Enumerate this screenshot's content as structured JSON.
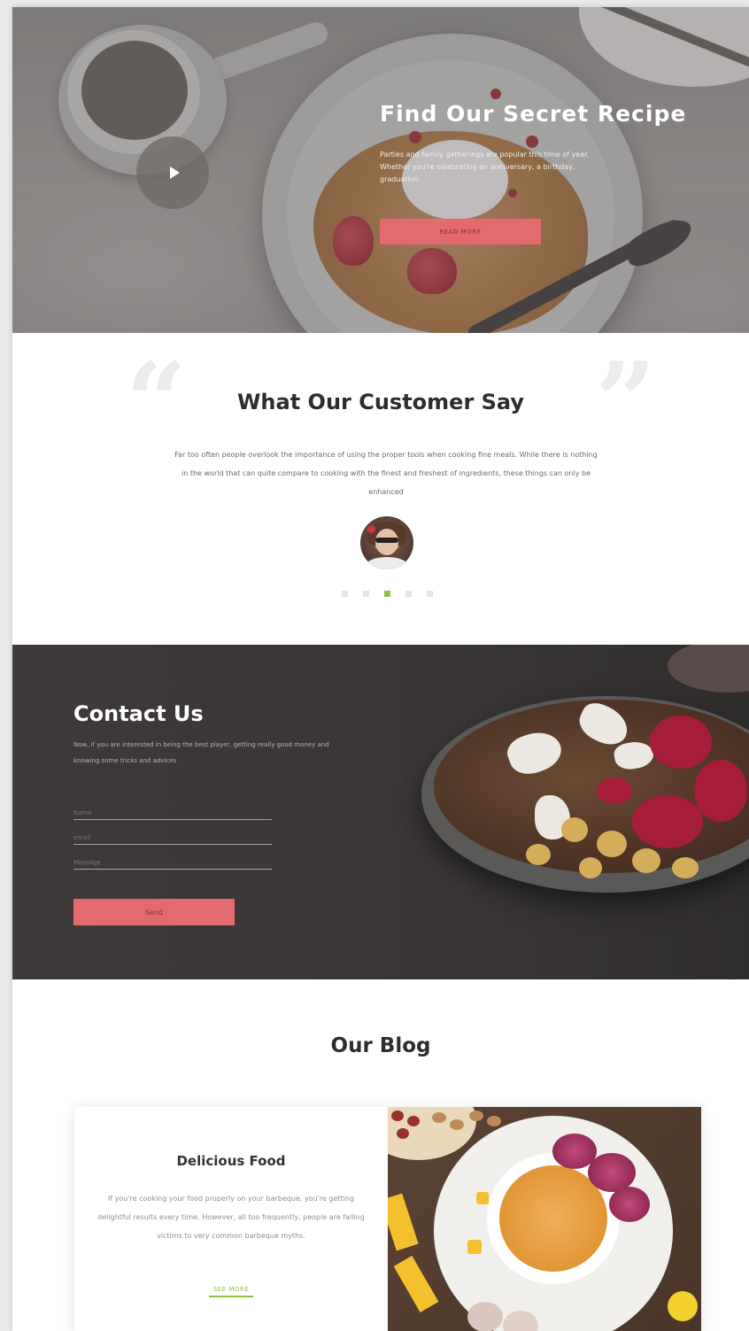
{
  "hero": {
    "title": "Find Our Secret Recipe",
    "text": "Parties and family gatherings are popular this time of year. Whether you're celebrating an anniversary, a birthday, graduation",
    "button_label": "READ MORE"
  },
  "testimonial": {
    "title": "What Our Customer Say",
    "text": "Far too often people overlook the importance of using the proper tools when cooking fine meals. While there is nothing in the world that can quite compare to cooking with the finest and freshest of ingredients, these things can only be enhanced",
    "active_dot": 3,
    "dot_count": 5
  },
  "contact": {
    "title": "Contact Us",
    "text": "Now, if you are interested in being the best player, getting really good money and knowing some tricks and advices",
    "name_placeholder": "Name",
    "email_placeholder": "email",
    "message_placeholder": "Message",
    "send_label": "Send"
  },
  "blog": {
    "title": "Our Blog",
    "card": {
      "title": "Delicious Food",
      "text": "If you're cooking your food properly on your barbeque, you're getting delightful results every time. However, all too frequently, people are falling victims to very common barbeque myths.",
      "link_label": "SEE MORE"
    }
  },
  "colors": {
    "accent": "#e36b6e",
    "green": "#8cc63f",
    "dark": "#3c3838"
  }
}
